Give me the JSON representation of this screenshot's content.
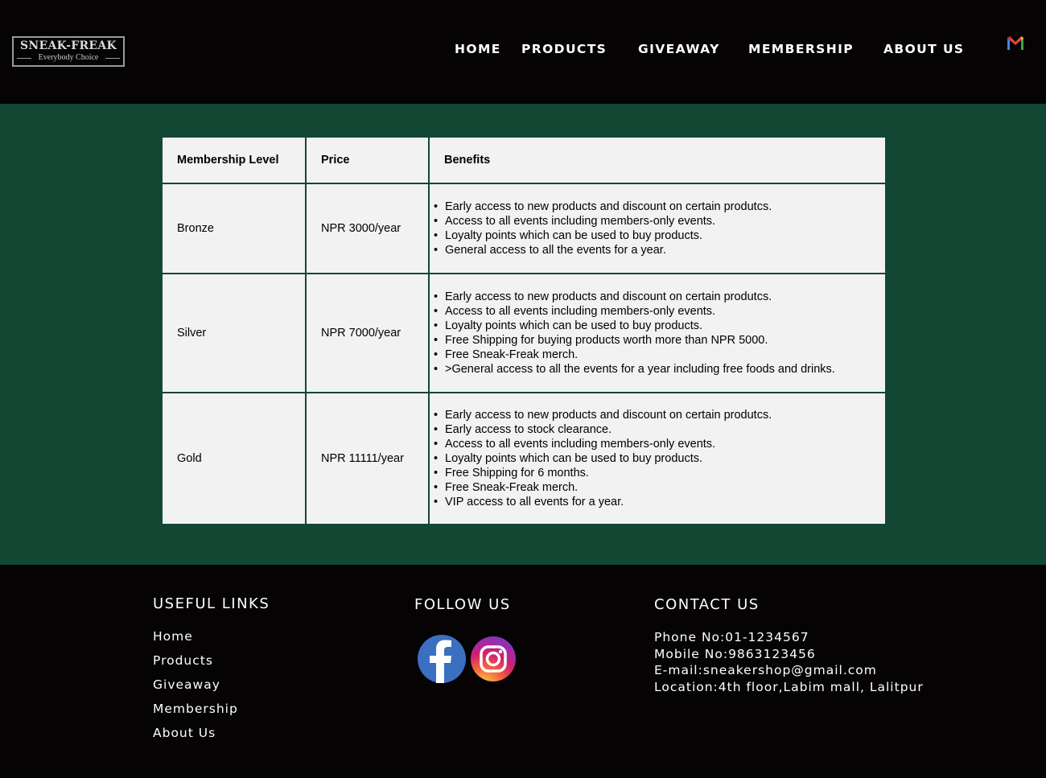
{
  "header": {
    "logo": {
      "title": "SNEAK-FREAK",
      "subtitle": "Everybody Choice"
    },
    "nav": [
      "HOME",
      "PRODUCTS",
      "GIVEAWAY",
      "MEMBERSHIP",
      "ABOUT US"
    ],
    "mail_icon": "gmail-icon"
  },
  "membership_table": {
    "headers": [
      "Membership Level",
      "Price",
      "Benefits"
    ],
    "rows": [
      {
        "level": "Bronze",
        "price": "NPR 3000/year",
        "benefits": [
          "Early access to new products and discount on certain produtcs.",
          "Access to all events including members-only events.",
          "Loyalty points which can be used to buy products.",
          "General access to all the events for a year."
        ]
      },
      {
        "level": "Silver",
        "price": "NPR 7000/year",
        "benefits": [
          "Early access to new products and discount on certain produtcs.",
          "Access to all events including members-only events.",
          "Loyalty points which can be used to buy products.",
          "Free Shipping for buying products worth more than NPR 5000.",
          "Free Sneak-Freak merch.",
          ">General access to all the events for a year including free foods and drinks."
        ]
      },
      {
        "level": "Gold",
        "price": "NPR 11111/year",
        "benefits": [
          "Early access to new products and discount on certain produtcs.",
          "Early access to stock clearance.",
          "Access to all events including members-only events.",
          "Loyalty points which can be used to buy products.",
          "Free Shipping for 6 months.",
          "Free Sneak-Freak merch.",
          "VIP access to all events for a year."
        ]
      }
    ]
  },
  "footer": {
    "useful_links": {
      "heading": "USEFUL LINKS",
      "links": [
        "Home",
        "Products",
        "Giveaway",
        "Membership",
        "About Us"
      ]
    },
    "follow_us": {
      "heading": "FOLLOW US",
      "icons": [
        "facebook-icon",
        "instagram-icon"
      ]
    },
    "contact_us": {
      "heading": "CONTACT US",
      "lines": [
        "Phone No:01-1234567",
        "Mobile No:9863123456",
        "E-mail:sneakershop@gmail.com",
        "Location:4th floor,Labim mall, Lalitpur"
      ]
    }
  }
}
